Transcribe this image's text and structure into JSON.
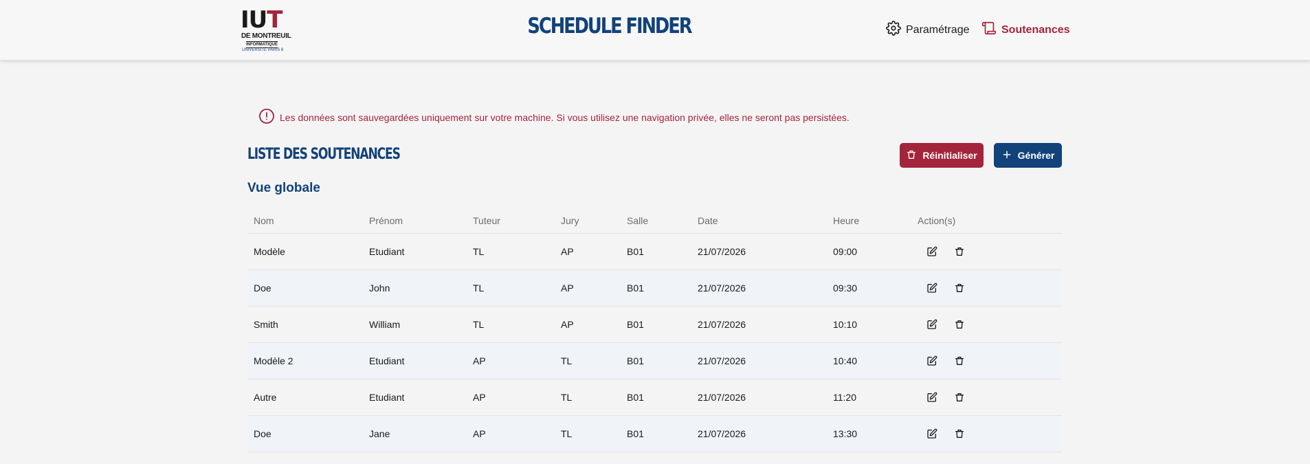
{
  "header": {
    "logo": {
      "main": "IUT",
      "line1": "DE MONTREUIL",
      "line2": "INFORMATIQUE",
      "line3": "UNIVERSITÉ PARIS 8"
    },
    "app_title": "SCHEDULE FINDER",
    "nav": {
      "settings_label": "Paramétrage",
      "settings_icon": "gear-icon",
      "defenses_label": "Soutenances",
      "defenses_icon": "scroll-icon"
    }
  },
  "alert": {
    "icon": "alert-circle-icon",
    "text": "Les données sont sauvegardées uniquement sur votre machine. Si vous utilisez une navigation privée, elles ne seront pas persistées."
  },
  "main": {
    "title": "LISTE DES SOUTENANCES",
    "reset_label": "Réinitialiser",
    "generate_label": "Générer",
    "subtitle": "Vue globale"
  },
  "table": {
    "headers": [
      "Nom",
      "Prénom",
      "Tuteur",
      "Jury",
      "Salle",
      "Date",
      "Heure",
      "Action(s)"
    ],
    "rows": [
      [
        "Modèle",
        "Etudiant",
        "TL",
        "AP",
        "B01",
        "21/07/2026",
        "09:00"
      ],
      [
        "Doe",
        "John",
        "TL",
        "AP",
        "B01",
        "21/07/2026",
        "09:30"
      ],
      [
        "Smith",
        "William",
        "TL",
        "AP",
        "B01",
        "21/07/2026",
        "10:10"
      ],
      [
        "Modèle 2",
        "Etudiant",
        "AP",
        "TL",
        "B01",
        "21/07/2026",
        "10:40"
      ],
      [
        "Autre",
        "Etudiant",
        "AP",
        "TL",
        "B01",
        "21/07/2026",
        "11:20"
      ],
      [
        "Doe",
        "Jane",
        "AP",
        "TL",
        "B01",
        "21/07/2026",
        "13:30"
      ]
    ]
  },
  "colors": {
    "primary_blue": "#12427a",
    "accent_red": "#a4243b",
    "background": "#f5f4f5",
    "row_alt": "#f0f3f8"
  }
}
